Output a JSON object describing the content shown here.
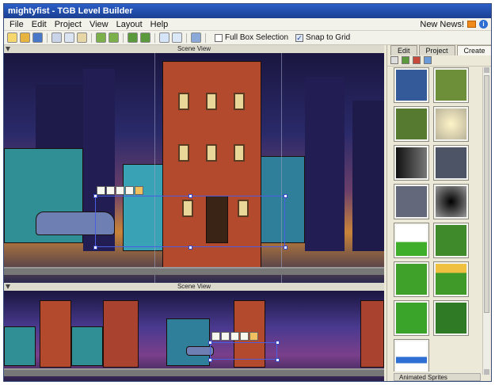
{
  "window": {
    "title": "mightyfist - TGB Level Builder"
  },
  "menubar": {
    "items": [
      "File",
      "Edit",
      "Project",
      "View",
      "Layout",
      "Help"
    ],
    "news_label": "New News!"
  },
  "toolbar": {
    "full_box_selection_label": "Full Box Selection",
    "snap_to_grid_label": "Snap to Grid",
    "full_box_selection_checked": false,
    "snap_to_grid_checked": true
  },
  "top_pane": {
    "title": "Scene View"
  },
  "bottom_pane": {
    "title": "Scene View"
  },
  "right_panel": {
    "tabs": [
      {
        "label": "Edit",
        "active": false
      },
      {
        "label": "Project",
        "active": false
      },
      {
        "label": "Create",
        "active": true
      }
    ],
    "thumbnails": [
      "car-sprite",
      "tree-sprite",
      "tree-sprite-2",
      "glow-sprite",
      "dark-gradient",
      "cloud-texture",
      "smoke-texture",
      "dark-circle",
      "grass-strip",
      "green-store",
      "green-building",
      "striped-awning-shop",
      "green-store-2",
      "green-shop-2",
      "water-strip"
    ],
    "accordion_label": "Animated Sprites"
  },
  "colors": {
    "accent": "#2b5fc7",
    "scene_bg": "#2a2a6a",
    "selection": "#4b5de0"
  }
}
